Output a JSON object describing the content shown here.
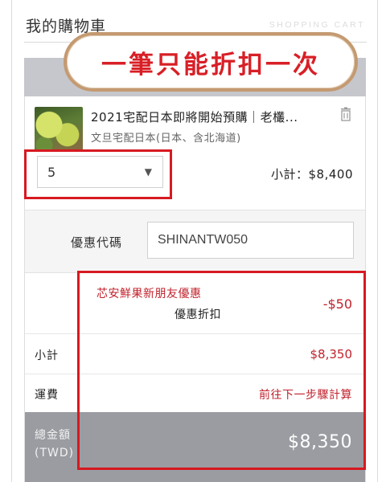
{
  "header": {
    "title": "我的購物車",
    "subtitle_en": "SHOPPING CART"
  },
  "callout": {
    "text": "一筆只能折扣一次"
  },
  "item": {
    "name": "2021宅配日本即將開始預購｜老欉...",
    "subtitle": "文旦宅配日本(日本、含北海道)",
    "quantity": "5",
    "subtotal": "小計：$8,400",
    "delete_icon": "trash-icon"
  },
  "coupon": {
    "label": "優惠代碼",
    "value": "SHINANTW050"
  },
  "discount": {
    "name": "芯安鮮果新朋友優惠",
    "label": "優惠折扣",
    "amount": "-$50"
  },
  "summary": {
    "subtotal_label": "小計",
    "subtotal_value": "$8,350",
    "shipping_label": "運費",
    "shipping_value": "前往下一步驟計算",
    "total_label_line1": "總金額",
    "total_label_line2": "(TWD)",
    "total_value": "$8,350"
  },
  "colors": {
    "accent_red": "#d71920",
    "price_red": "#c0222c",
    "callout_border": "#c49a71",
    "total_bar": "#9a9ca1"
  }
}
